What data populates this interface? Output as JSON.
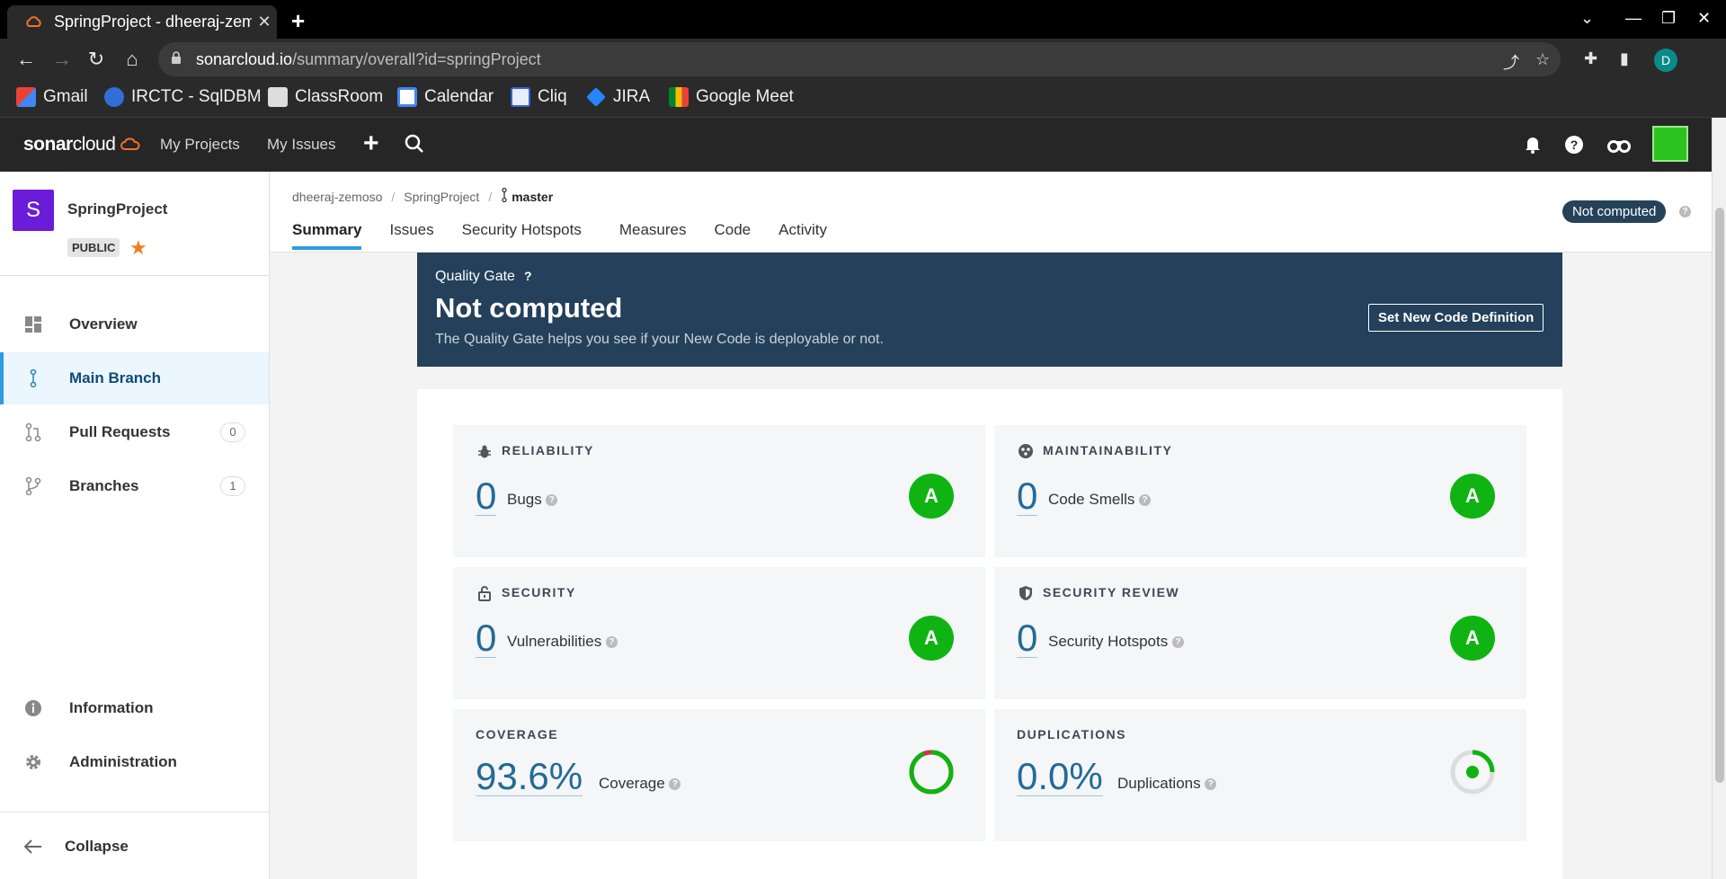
{
  "browser": {
    "tab_title": "SpringProject - dheeraj-zemoso",
    "tab_close": "✕",
    "new_tab": "+",
    "url_domain": "sonarcloud.io",
    "url_path": "/summary/overall?id=springProject",
    "profile_initial": "D",
    "bookmarks": [
      "Gmail",
      "IRCTC - SqlDBM",
      "ClassRoom",
      "Calendar",
      "Cliq",
      "JIRA",
      "Google Meet"
    ]
  },
  "header": {
    "logo_bold": "sonar",
    "logo_thin": "cloud",
    "nav": [
      "My Projects",
      "My Issues"
    ]
  },
  "sidebar": {
    "project_initial": "S",
    "project_name": "SpringProject",
    "visibility": "PUBLIC",
    "items": [
      {
        "label": "Overview"
      },
      {
        "label": "Main Branch"
      },
      {
        "label": "Pull Requests",
        "count": "0"
      },
      {
        "label": "Branches",
        "count": "1"
      },
      {
        "label": "Information"
      },
      {
        "label": "Administration"
      },
      {
        "label": "Collapse"
      }
    ]
  },
  "breadcrumb": {
    "org": "dheeraj-zemoso",
    "project": "SpringProject",
    "branch": "master"
  },
  "tabs": [
    "Summary",
    "Issues",
    "Security Hotspots",
    "Measures",
    "Code",
    "Activity"
  ],
  "status_badge": "Not computed",
  "quality_gate": {
    "label": "Quality Gate",
    "help": "?",
    "status": "Not computed",
    "description": "The Quality Gate helps you see if your New Code is deployable or not.",
    "button": "Set New Code Definition"
  },
  "metrics": {
    "reliability": {
      "title": "RELIABILITY",
      "value": "0",
      "metric": "Bugs",
      "rating": "A"
    },
    "maintainability": {
      "title": "MAINTAINABILITY",
      "value": "0",
      "metric": "Code Smells",
      "rating": "A"
    },
    "security": {
      "title": "SECURITY",
      "value": "0",
      "metric": "Vulnerabilities",
      "rating": "A"
    },
    "security_review": {
      "title": "SECURITY REVIEW",
      "value": "0",
      "metric": "Security Hotspots",
      "rating": "A"
    },
    "coverage": {
      "title": "COVERAGE",
      "value": "93.6%",
      "metric": "Coverage",
      "fraction": 0.936
    },
    "duplications": {
      "title": "DUPLICATIONS",
      "value": "0.0%",
      "metric": "Duplications",
      "fraction": 0.0
    }
  },
  "colors": {
    "accent": "#2d9de0",
    "quality_gate_bg": "#24405a",
    "rating_a": "#0fb413",
    "value_blue": "#236a97"
  }
}
